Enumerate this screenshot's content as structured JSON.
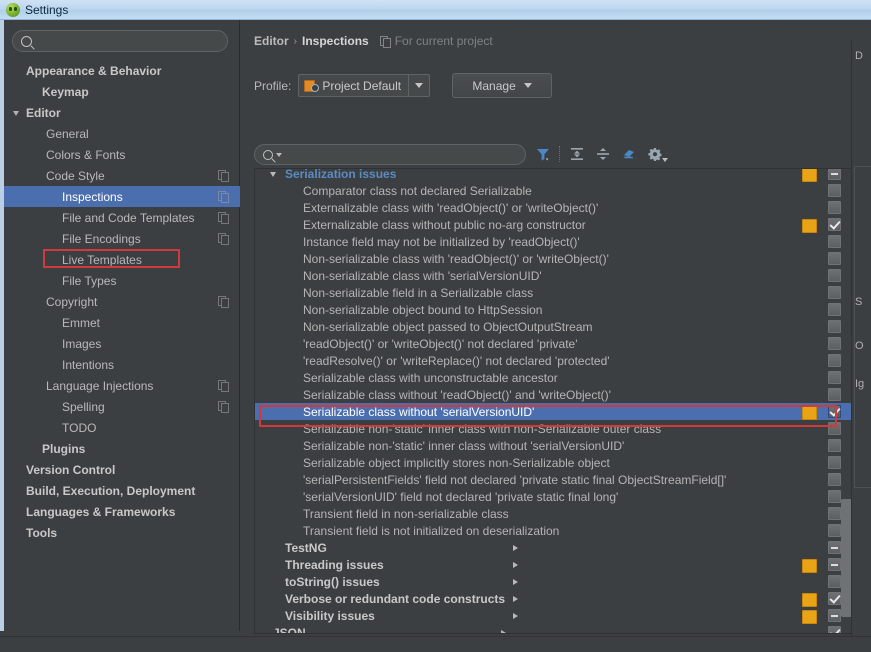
{
  "window": {
    "title": "Settings",
    "icon": "intellij-app-icon"
  },
  "sidebar": {
    "search": {
      "value": "",
      "placeholder": ""
    },
    "items": [
      {
        "label": "Appearance & Behavior",
        "arrow": "right",
        "bold": true,
        "indent": 8,
        "copy": false,
        "selected": false
      },
      {
        "label": "Keymap",
        "arrow": "none",
        "bold": true,
        "indent": 24,
        "copy": false,
        "selected": false
      },
      {
        "label": "Editor",
        "arrow": "down",
        "bold": true,
        "indent": 8,
        "copy": false,
        "selected": false
      },
      {
        "label": "General",
        "arrow": "right",
        "bold": false,
        "indent": 28,
        "copy": false,
        "selected": false
      },
      {
        "label": "Colors & Fonts",
        "arrow": "right",
        "bold": false,
        "indent": 28,
        "copy": false,
        "selected": false
      },
      {
        "label": "Code Style",
        "arrow": "right",
        "bold": false,
        "indent": 28,
        "copy": true,
        "selected": false
      },
      {
        "label": "Inspections",
        "arrow": "none",
        "bold": false,
        "indent": 44,
        "copy": true,
        "selected": true
      },
      {
        "label": "File and Code Templates",
        "arrow": "none",
        "bold": false,
        "indent": 44,
        "copy": true,
        "selected": false
      },
      {
        "label": "File Encodings",
        "arrow": "none",
        "bold": false,
        "indent": 44,
        "copy": true,
        "selected": false
      },
      {
        "label": "Live Templates",
        "arrow": "none",
        "bold": false,
        "indent": 44,
        "copy": false,
        "selected": false
      },
      {
        "label": "File Types",
        "arrow": "none",
        "bold": false,
        "indent": 44,
        "copy": false,
        "selected": false
      },
      {
        "label": "Copyright",
        "arrow": "right",
        "bold": false,
        "indent": 28,
        "copy": true,
        "selected": false
      },
      {
        "label": "Emmet",
        "arrow": "none",
        "bold": false,
        "indent": 44,
        "copy": false,
        "selected": false
      },
      {
        "label": "Images",
        "arrow": "none",
        "bold": false,
        "indent": 44,
        "copy": false,
        "selected": false
      },
      {
        "label": "Intentions",
        "arrow": "none",
        "bold": false,
        "indent": 44,
        "copy": false,
        "selected": false
      },
      {
        "label": "Language Injections",
        "arrow": "right",
        "bold": false,
        "indent": 28,
        "copy": true,
        "selected": false
      },
      {
        "label": "Spelling",
        "arrow": "none",
        "bold": false,
        "indent": 44,
        "copy": true,
        "selected": false
      },
      {
        "label": "TODO",
        "arrow": "none",
        "bold": false,
        "indent": 44,
        "copy": false,
        "selected": false
      },
      {
        "label": "Plugins",
        "arrow": "none",
        "bold": true,
        "indent": 24,
        "copy": false,
        "selected": false
      },
      {
        "label": "Version Control",
        "arrow": "right",
        "bold": true,
        "indent": 8,
        "copy": false,
        "selected": false
      },
      {
        "label": "Build, Execution, Deployment",
        "arrow": "right",
        "bold": true,
        "indent": 8,
        "copy": false,
        "selected": false
      },
      {
        "label": "Languages & Frameworks",
        "arrow": "right",
        "bold": true,
        "indent": 8,
        "copy": false,
        "selected": false
      },
      {
        "label": "Tools",
        "arrow": "right",
        "bold": true,
        "indent": 8,
        "copy": false,
        "selected": false
      }
    ]
  },
  "breadcrumb": {
    "parent": "Editor",
    "separator": "›",
    "current": "Inspections",
    "scope_icon": "copy-scope-icon",
    "scope_text": "For current project"
  },
  "profile": {
    "label": "Profile:",
    "icon": "profile-icon",
    "value": "Project Default",
    "dropdown_icon": "chevron-down-icon",
    "manage_label": "Manage",
    "manage_caret": "chevron-down-icon"
  },
  "inspection_search": {
    "value": "",
    "placeholder": ""
  },
  "toolbar_icons": [
    {
      "name": "filter-icon",
      "color": "#4a87c9"
    },
    {
      "name": "expand-all-icon",
      "color": "#9aa7b0"
    },
    {
      "name": "collapse-all-icon",
      "color": "#9aa7b0"
    },
    {
      "name": "reset-to-empty-icon",
      "color": "#4a87c9"
    },
    {
      "name": "settings-gear-icon",
      "color": "#9aa7b0"
    }
  ],
  "inspections": {
    "rows": [
      {
        "text": "Serialization issues",
        "type": "group",
        "arrow": "down",
        "color": "blue",
        "severity": "warn",
        "check": "partial",
        "clipped": true
      },
      {
        "text": "Comparator class not declared Serializable",
        "type": "leaf",
        "severity": "none",
        "check": "none"
      },
      {
        "text": "Externalizable class with 'readObject()' or 'writeObject()'",
        "type": "leaf",
        "severity": "none",
        "check": "none"
      },
      {
        "text": "Externalizable class without public no-arg constructor",
        "type": "leaf",
        "severity": "warn",
        "check": "checked"
      },
      {
        "text": "Instance field may not be initialized by 'readObject()'",
        "type": "leaf",
        "severity": "none",
        "check": "none"
      },
      {
        "text": "Non-serializable class with 'readObject()' or 'writeObject()'",
        "type": "leaf",
        "severity": "none",
        "check": "none"
      },
      {
        "text": "Non-serializable class with 'serialVersionUID'",
        "type": "leaf",
        "severity": "none",
        "check": "none"
      },
      {
        "text": "Non-serializable field in a Serializable class",
        "type": "leaf",
        "severity": "none",
        "check": "none"
      },
      {
        "text": "Non-serializable object bound to HttpSession",
        "type": "leaf",
        "severity": "none",
        "check": "none"
      },
      {
        "text": "Non-serializable object passed to ObjectOutputStream",
        "type": "leaf",
        "severity": "none",
        "check": "none"
      },
      {
        "text": "'readObject()' or 'writeObject()' not declared 'private'",
        "type": "leaf",
        "severity": "none",
        "check": "none"
      },
      {
        "text": "'readResolve()' or 'writeReplace()' not declared 'protected'",
        "type": "leaf",
        "severity": "none",
        "check": "none"
      },
      {
        "text": "Serializable class with unconstructable ancestor",
        "type": "leaf",
        "severity": "none",
        "check": "none"
      },
      {
        "text": "Serializable class without 'readObject()' and 'writeObject()'",
        "type": "leaf",
        "severity": "none",
        "check": "none"
      },
      {
        "text": "Serializable class without 'serialVersionUID'",
        "type": "leaf",
        "severity": "warn",
        "check": "checked",
        "selected": true,
        "highlighted": true
      },
      {
        "text": "Serializable non-'static' inner class with non-Serializable outer class",
        "type": "leaf",
        "severity": "none",
        "check": "none"
      },
      {
        "text": "Serializable non-'static' inner class without 'serialVersionUID'",
        "type": "leaf",
        "severity": "none",
        "check": "none"
      },
      {
        "text": "Serializable object implicitly stores non-Serializable object",
        "type": "leaf",
        "severity": "none",
        "check": "none"
      },
      {
        "text": "'serialPersistentFields' field not declared 'private static final ObjectStreamField[]'",
        "type": "leaf",
        "severity": "none",
        "check": "none"
      },
      {
        "text": "'serialVersionUID' field not declared 'private static final long'",
        "type": "leaf",
        "severity": "none",
        "check": "none"
      },
      {
        "text": "Transient field in non-serializable class",
        "type": "leaf",
        "severity": "none",
        "check": "none"
      },
      {
        "text": "Transient field is not initialized on deserialization",
        "type": "leaf",
        "severity": "none",
        "check": "none"
      },
      {
        "text": "TestNG",
        "type": "group",
        "arrow": "right",
        "severity": "none",
        "check": "partial"
      },
      {
        "text": "Threading issues",
        "type": "group",
        "arrow": "right",
        "severity": "warn",
        "check": "partial"
      },
      {
        "text": "toString() issues",
        "type": "group",
        "arrow": "right",
        "severity": "none",
        "check": "none"
      },
      {
        "text": "Verbose or redundant code constructs",
        "type": "group",
        "arrow": "right",
        "severity": "warn",
        "check": "checked"
      },
      {
        "text": "Visibility issues",
        "type": "group",
        "arrow": "right",
        "severity": "warn",
        "check": "partial"
      },
      {
        "text": "JSON",
        "type": "group",
        "arrow": "right",
        "severity": "none",
        "check": "checked",
        "clipped": true
      }
    ]
  },
  "side_panel": {
    "fragments": [
      "D",
      "S",
      "O",
      "Ig"
    ]
  },
  "colors": {
    "accent_selection": "#4b6eaf",
    "highlight_outline": "#d03a3a",
    "warning_severity": "#e8a317",
    "group_blue": "#5b8bc4",
    "panel_bg": "#3c3f41",
    "titlebar": "#bcd7ef"
  }
}
